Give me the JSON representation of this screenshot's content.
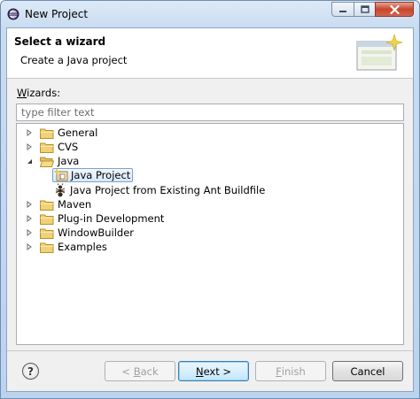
{
  "window": {
    "title": "New Project"
  },
  "header": {
    "title": "Select a wizard",
    "subtitle": "Create a Java project"
  },
  "wizards": {
    "label_mnemonic": "W",
    "label_rest": "izards:",
    "filter_placeholder": "type filter text"
  },
  "tree": {
    "items": [
      {
        "label": "General",
        "expanded": false,
        "icon": "folder-icon"
      },
      {
        "label": "CVS",
        "expanded": false,
        "icon": "folder-icon"
      },
      {
        "label": "Java",
        "expanded": true,
        "icon": "folder-icon"
      },
      {
        "label": "Java Project",
        "selected": true,
        "icon": "java-project-icon"
      },
      {
        "label": "Java Project from Existing Ant Buildfile",
        "icon": "ant-icon"
      },
      {
        "label": "Maven",
        "expanded": false,
        "icon": "folder-icon"
      },
      {
        "label": "Plug-in Development",
        "expanded": false,
        "icon": "folder-icon"
      },
      {
        "label": "WindowBuilder",
        "expanded": false,
        "icon": "folder-icon"
      },
      {
        "label": "Examples",
        "expanded": false,
        "icon": "folder-icon"
      }
    ]
  },
  "buttons": {
    "back": {
      "prefix": "< ",
      "mnemonic": "B",
      "rest": "ack",
      "enabled": false
    },
    "next": {
      "mnemonic": "N",
      "rest": "ext >",
      "enabled": true
    },
    "finish": {
      "mnemonic": "F",
      "rest": "inish",
      "enabled": false
    },
    "cancel": {
      "label": "Cancel",
      "enabled": true
    }
  },
  "help": {
    "glyph": "?"
  },
  "colors": {
    "selection_border": "#7da2ce",
    "folder": "#e8c35a",
    "window_border": "#6d8db5"
  }
}
